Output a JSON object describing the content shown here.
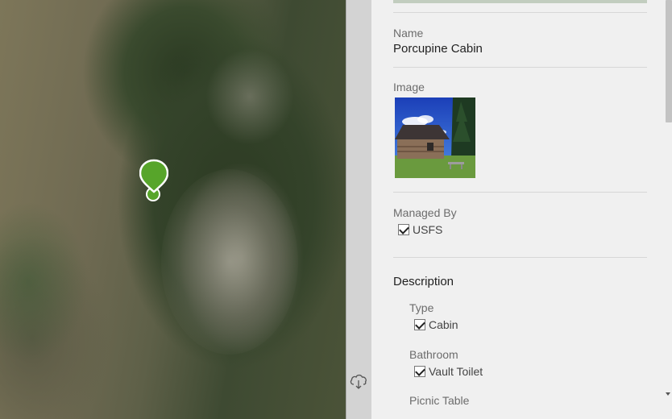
{
  "map": {
    "pin_icon": "map-marker-icon",
    "pin_color": "#57a52a"
  },
  "panel": {
    "name": {
      "label": "Name",
      "value": "Porcupine Cabin"
    },
    "image": {
      "label": "Image"
    },
    "managed_by": {
      "label": "Managed By",
      "option": "USFS",
      "checked": true
    },
    "description": {
      "title": "Description",
      "type": {
        "label": "Type",
        "option": "Cabin",
        "checked": true
      },
      "bathroom": {
        "label": "Bathroom",
        "option": "Vault Toilet",
        "checked": true
      },
      "picnic_table": {
        "label": "Picnic Table"
      }
    }
  },
  "toolbar": {
    "cloud_icon": "cloud-download-icon"
  }
}
